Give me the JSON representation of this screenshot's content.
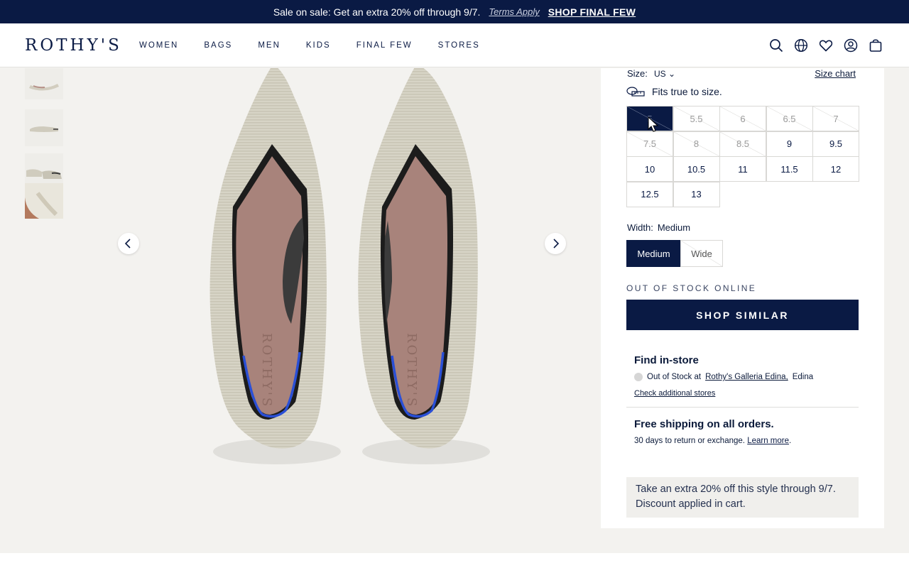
{
  "promo": {
    "text": "Sale on sale: Get an extra 20% off through 9/7.",
    "terms": "Terms Apply",
    "cta": "SHOP FINAL FEW"
  },
  "header": {
    "logo": "ROTHY'S",
    "nav": [
      "WOMEN",
      "BAGS",
      "MEN",
      "KIDS",
      "FINAL FEW",
      "STORES"
    ],
    "icons": [
      "search-icon",
      "globe-icon",
      "heart-icon",
      "account-icon",
      "bag-icon"
    ]
  },
  "product": {
    "size_label": "Size:",
    "size_system": "US",
    "size_chart": "Size chart",
    "fit_note": "Fits true to size.",
    "sizes": [
      {
        "label": "5",
        "available": false,
        "selected": true
      },
      {
        "label": "5.5",
        "available": false
      },
      {
        "label": "6",
        "available": false
      },
      {
        "label": "6.5",
        "available": false
      },
      {
        "label": "7",
        "available": false
      },
      {
        "label": "7.5",
        "available": false
      },
      {
        "label": "8",
        "available": false
      },
      {
        "label": "8.5",
        "available": false
      },
      {
        "label": "9",
        "available": true
      },
      {
        "label": "9.5",
        "available": true
      },
      {
        "label": "10",
        "available": true
      },
      {
        "label": "10.5",
        "available": true
      },
      {
        "label": "11",
        "available": true
      },
      {
        "label": "11.5",
        "available": true
      },
      {
        "label": "12",
        "available": true
      },
      {
        "label": "12.5",
        "available": true
      },
      {
        "label": "13",
        "available": true
      }
    ],
    "width_label": "Width:",
    "width_value": "Medium",
    "widths": [
      {
        "label": "Medium",
        "selected": true,
        "available": true
      },
      {
        "label": "Wide",
        "selected": false,
        "available": false
      }
    ],
    "stock_status": "OUT OF STOCK ONLINE",
    "shop_similar": "SHOP SIMILAR"
  },
  "find_in_store": {
    "title": "Find in-store",
    "status_prefix": "Out of Stock at",
    "store": "Rothy's Galleria Edina,",
    "city": "Edina",
    "check_link": "Check additional stores"
  },
  "shipping": {
    "title": "Free shipping on all orders.",
    "subtitle": "30 days to return or exchange.",
    "learn_more": "Learn more",
    "period": "."
  },
  "discount_note": "Take an extra 20% off this style through 9/7. Discount applied in cart.",
  "colors": {
    "navy": "#0a1a44",
    "background": "#f3f2ef",
    "insole": "#a8837b",
    "knit": "#d8d5c8",
    "heel_accent": "#2a4fd6"
  }
}
